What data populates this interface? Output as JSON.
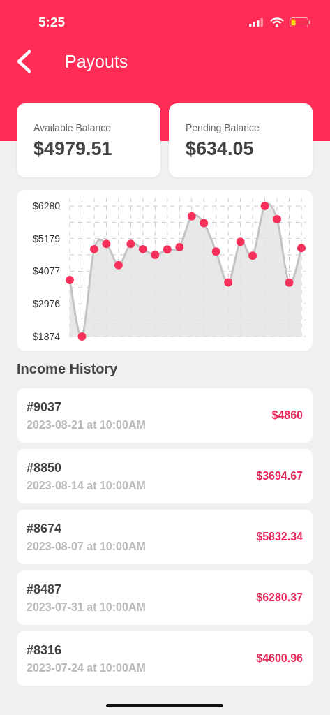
{
  "status_bar": {
    "time": "5:25"
  },
  "nav": {
    "title": "Payouts"
  },
  "balances": [
    {
      "label": "Available Balance",
      "amount": "$4979.51"
    },
    {
      "label": "Pending Balance",
      "amount": "$634.05"
    }
  ],
  "income_chart": {
    "chart_data": {
      "type": "area",
      "grid": true,
      "series": [
        {
          "color": "#f5305a",
          "values": [
            3780,
            1870,
            4820,
            5000,
            4280,
            5000,
            4820,
            4630,
            4810,
            4890,
            5930,
            5700,
            4740,
            3700,
            5070,
            4600,
            6280,
            5830,
            3690,
            4860
          ]
        }
      ],
      "ylim": [
        1870,
        6550
      ],
      "yticks": [
        {
          "value": 6280,
          "label": "$6280"
        },
        {
          "value": 5179,
          "label": "$5179"
        },
        {
          "value": 4077,
          "label": "$4077"
        },
        {
          "value": 2976,
          "label": "$2976"
        },
        {
          "value": 1874,
          "label": "$1874"
        }
      ]
    }
  },
  "income_history": {
    "title": "Income History",
    "items": [
      {
        "id": "#9037",
        "date": "2023-08-21 at 10:00AM",
        "amount": "$4860"
      },
      {
        "id": "#8850",
        "date": "2023-08-14 at 10:00AM",
        "amount": "$3694.67"
      },
      {
        "id": "#8674",
        "date": "2023-08-07 at 10:00AM",
        "amount": "$5832.34"
      },
      {
        "id": "#8487",
        "date": "2023-07-31 at 10:00AM",
        "amount": "$6280.37"
      },
      {
        "id": "#8316",
        "date": "2023-07-24 at 10:00AM",
        "amount": "$4600.96"
      }
    ]
  }
}
